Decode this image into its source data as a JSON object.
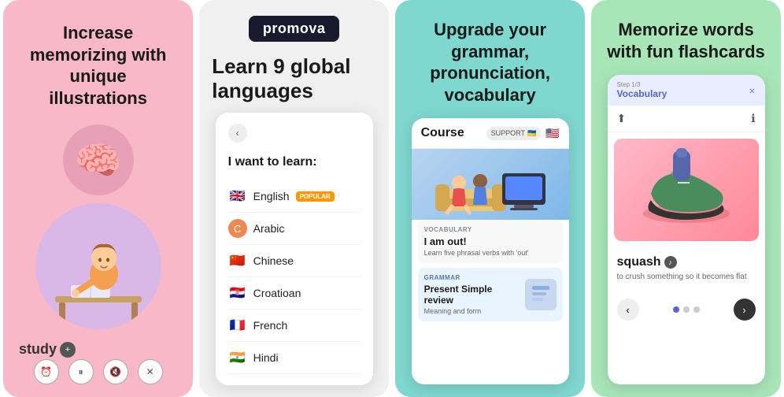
{
  "panel1": {
    "title": "Increase memorizing with unique illustrations",
    "study_label": "study",
    "brain_emoji": "🧠",
    "controls": [
      "⏰",
      "⏸",
      "🔇",
      "✕"
    ]
  },
  "panel2": {
    "logo": "promova",
    "title": "Learn 9 global languages",
    "phone": {
      "learn_prompt": "I want to learn:",
      "languages": [
        {
          "flag": "🇬🇧",
          "name": "English",
          "popular": true
        },
        {
          "flag": "🌙",
          "name": "Arabic",
          "popular": false
        },
        {
          "flag": "🇨🇳",
          "name": "Chinese",
          "popular": false
        },
        {
          "flag": "🇭🇷",
          "name": "Croatioan",
          "popular": false
        },
        {
          "flag": "🇫🇷",
          "name": "French",
          "popular": false
        },
        {
          "flag": "🇮🇳",
          "name": "Hindi",
          "popular": false
        }
      ],
      "popular_label": "POPULAR"
    }
  },
  "panel3": {
    "title": "Upgrade your grammar, pronunciation, vocabulary",
    "phone": {
      "course_label": "Course",
      "support_label": "SUPPORT",
      "vocab_tag": "VOCABULARY",
      "vocab_title": "I am out!",
      "vocab_desc": "Learn five phrasal verbs with 'out'",
      "grammar_tag": "GRAMMAR",
      "grammar_title": "Present Simple review",
      "grammar_sub": "Meaning and form"
    }
  },
  "panel4": {
    "title": "Memorize words with fun flashcards",
    "phone": {
      "step_label": "Step 1/3",
      "vocab_section": "Vocabulary",
      "word": "squash",
      "word_definition": "to crush something so it becomes flat",
      "close_label": "×"
    }
  }
}
